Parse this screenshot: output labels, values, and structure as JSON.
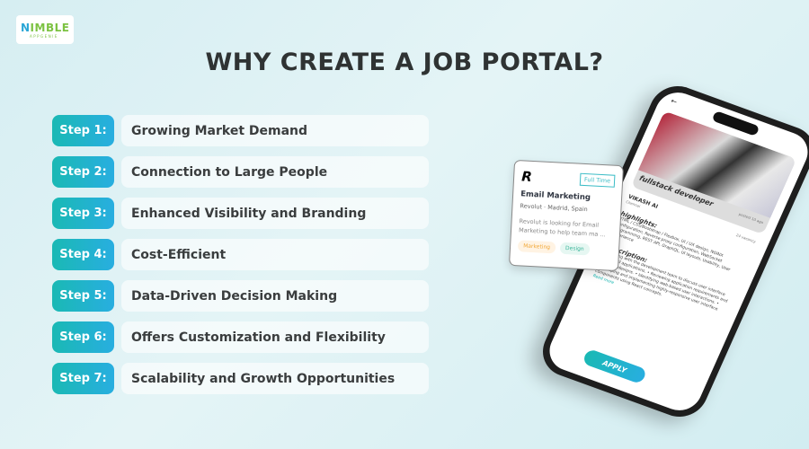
{
  "logo": {
    "text_main": "IMBLE",
    "text_initial": "N",
    "text_sub": "APPGENIE"
  },
  "title": "WHY CREATE A JOB PORTAL?",
  "steps": [
    {
      "label": "Step 1:",
      "text": "Growing Market Demand"
    },
    {
      "label": "Step 2:",
      "text": "Connection to Large People"
    },
    {
      "label": "Step 3:",
      "text": "Enhanced Visibility and Branding"
    },
    {
      "label": "Step 4:",
      "text": "Cost-Efficient"
    },
    {
      "label": "Step 5:",
      "text": "Data-Driven Decision Making"
    },
    {
      "label": "Step 6:",
      "text": "Offers Customization and Flexibility"
    },
    {
      "label": "Step 7:",
      "text": "Scalability and Growth Opportunities"
    }
  ],
  "card": {
    "logo": "R",
    "type": "Full Time",
    "title": "Email Marketing",
    "company": "Revolut  ·  Madrid, Spain",
    "desc": "Revolut is looking for Email Marketing to help team ma ...",
    "tags": [
      "Marketing",
      "Design"
    ]
  },
  "phone": {
    "back": "←",
    "job_title": "fullstack developer",
    "posted": "posted 10 ago",
    "company": "VIKASH AI",
    "company_sub": "Chennai",
    "vacancy": "24 vacancy",
    "highlights_title": "highlights:",
    "highlights": "HTML / CSS/Bootstrap / Flexbox, UI / UX design, NGINX Configuration, Reverse proxy configuration, WebSocket Programming, REST API, GraphQL, UI layouts, Usability, User experience",
    "description_title": "Description:",
    "description": "• Meeting with the development team to discuss user interface ideas and applications. • Reviewing application requirements and interface designs. • Identifying web-based user interactions. • Developing and implementing highly-responsive user interface components using React concepts.",
    "read_more": "Read more",
    "apply": "APPLY"
  },
  "colors": {
    "accent_start": "#1ab9b4",
    "accent_end": "#28aee0",
    "title": "#2f3333"
  }
}
